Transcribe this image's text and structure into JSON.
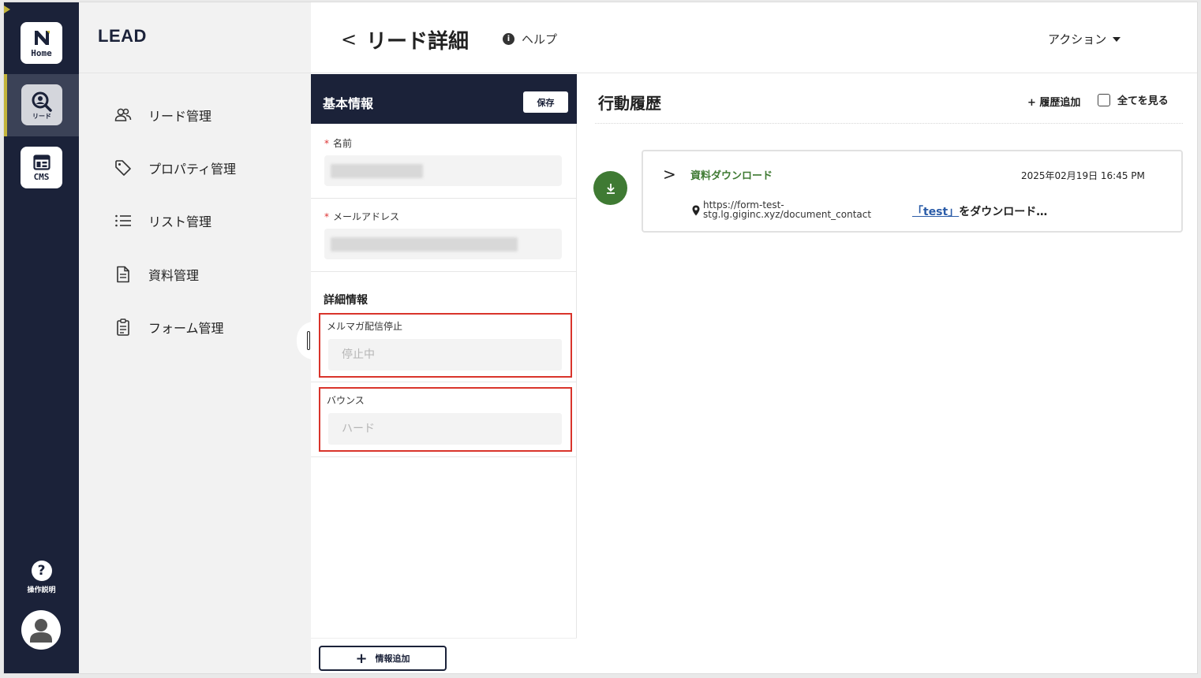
{
  "rail": {
    "home_label": "Home",
    "lead_label": "リード",
    "cms_label": "CMS",
    "help_label": "操作説明",
    "help_glyph": "?",
    "accent_color": "#c3b43a"
  },
  "menu": {
    "brand": "LEAD",
    "items": [
      {
        "label": "リード管理",
        "icon": "users-icon"
      },
      {
        "label": "プロパティ管理",
        "icon": "tag-icon"
      },
      {
        "label": "リスト管理",
        "icon": "list-icon"
      },
      {
        "label": "資料管理",
        "icon": "document-icon"
      },
      {
        "label": "フォーム管理",
        "icon": "clipboard-icon"
      }
    ]
  },
  "header": {
    "back_glyph": "<",
    "title": "リード詳細",
    "help_icon": "i",
    "help_label": "ヘルプ",
    "action_label": "アクション"
  },
  "info_panel": {
    "title": "基本情報",
    "save_label": "保存",
    "fields": [
      {
        "required": "*",
        "label": "名前",
        "value": ""
      },
      {
        "required": "*",
        "label": "メールアドレス",
        "value": ""
      }
    ],
    "detail_title": "詳細情報",
    "detail_fields": [
      {
        "label": "メルマガ配信停止",
        "placeholder": "停止中"
      },
      {
        "label": "バウンス",
        "placeholder": "ハード"
      }
    ],
    "add_plus": "+",
    "add_label": "情報追加"
  },
  "history": {
    "title": "行動履歴",
    "add_label": "+ 履歴追加",
    "show_all_label": "全てを見る",
    "show_all_checked": false,
    "events": [
      {
        "chevron": ">",
        "type": "資料ダウンロード",
        "date": "2025年02月19日 16:45 PM",
        "url_line1": "https://form-test-",
        "url_line2": "stg.lg.giginc.xyz/document_contact",
        "link_text": "「test」",
        "desc_suffix": "をダウンロード…",
        "color": "#3f7a33"
      }
    ]
  }
}
